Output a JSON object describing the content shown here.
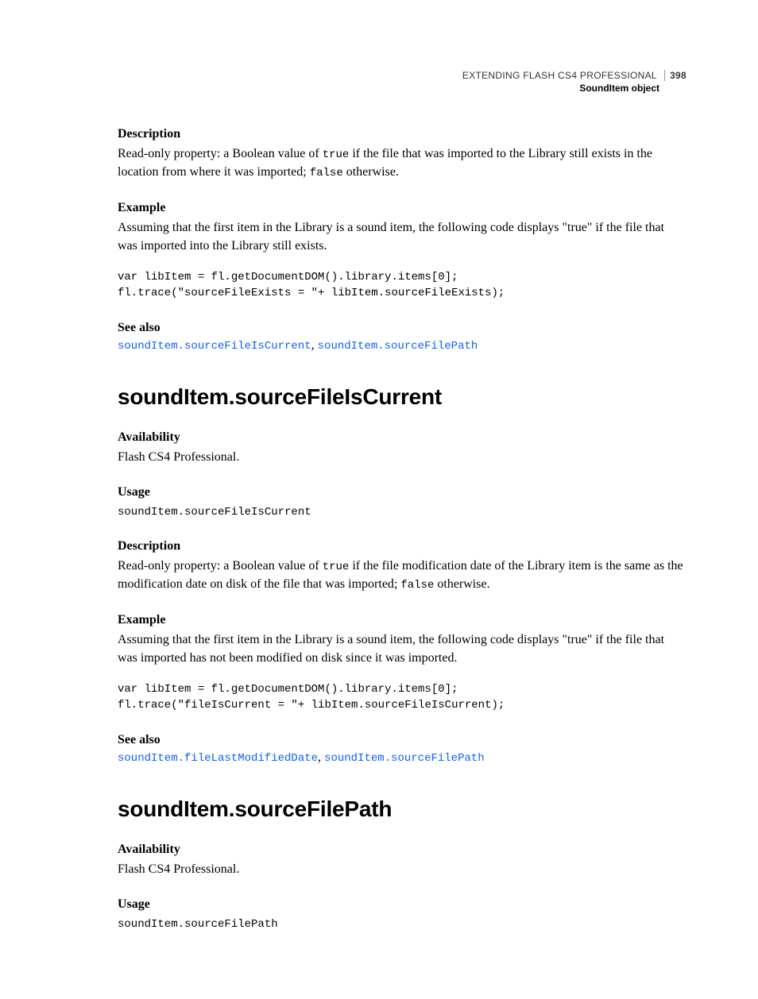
{
  "header": {
    "title": "EXTENDING FLASH CS4 PROFESSIONAL",
    "page_number": "398",
    "section": "SoundItem object"
  },
  "section1": {
    "desc_label": "Description",
    "desc_pre": "Read-only property: a Boolean value of ",
    "desc_true": "true",
    "desc_mid": " if the file that was imported to the Library still exists in the location from where it was imported; ",
    "desc_false": "false",
    "desc_post": " otherwise.",
    "example_label": "Example",
    "example_text": "Assuming that the first item in the Library is a sound item, the following code displays \"true\" if the file that was imported into the Library still exists.",
    "code": "var libItem = fl.getDocumentDOM().library.items[0];\nfl.trace(\"sourceFileExists = \"+ libItem.sourceFileExists);",
    "seealso_label": "See also",
    "link1": "soundItem.sourceFileIsCurrent",
    "link2": "soundItem.sourceFilePath"
  },
  "section2": {
    "heading": "soundItem.sourceFileIsCurrent",
    "avail_label": "Availability",
    "avail_text": "Flash CS4 Professional.",
    "usage_label": "Usage",
    "usage_code": "soundItem.sourceFileIsCurrent",
    "desc_label": "Description",
    "desc_pre": "Read-only property: a Boolean value of ",
    "desc_true": "true",
    "desc_mid": " if the file modification date of the Library item is the same as the modification date on disk of the file that was imported; ",
    "desc_false": "false",
    "desc_post": " otherwise.",
    "example_label": "Example",
    "example_text": "Assuming that the first item in the Library is a sound item, the following code displays \"true\" if the file that was imported has not been modified on disk since it was imported.",
    "code": "var libItem = fl.getDocumentDOM().library.items[0];\nfl.trace(\"fileIsCurrent = \"+ libItem.sourceFileIsCurrent);",
    "seealso_label": "See also",
    "link1": "soundItem.fileLastModifiedDate",
    "link2": "soundItem.sourceFilePath"
  },
  "section3": {
    "heading": "soundItem.sourceFilePath",
    "avail_label": "Availability",
    "avail_text": "Flash CS4 Professional.",
    "usage_label": "Usage",
    "usage_code": "soundItem.sourceFilePath"
  }
}
